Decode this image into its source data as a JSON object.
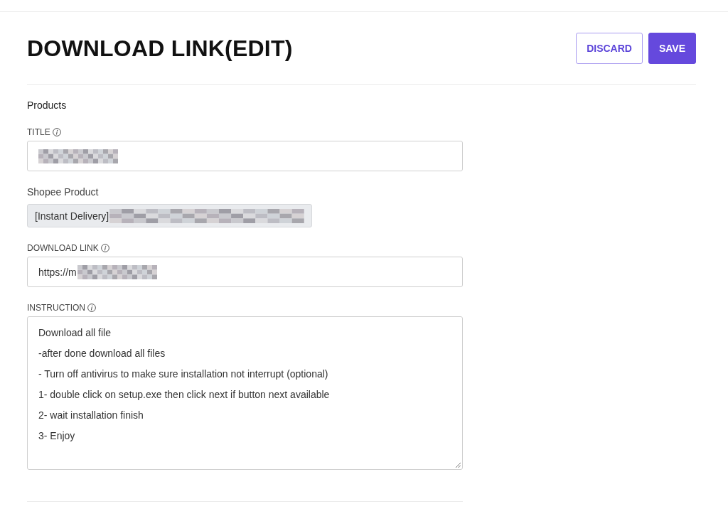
{
  "header": {
    "title": "DOWNLOAD LINK(EDIT)",
    "buttons": [
      {
        "label": "DISCARD",
        "kind": "outline"
      },
      {
        "label": "SAVE",
        "kind": "primary"
      }
    ]
  },
  "form": {
    "section": "Products",
    "fields": [
      {
        "kind": "text",
        "label": "TITLE",
        "info": true,
        "disabled": false,
        "redacted": true
      },
      {
        "kind": "readonly",
        "label": "Shopee Product",
        "info": false,
        "disabled": true,
        "value": "[Instant Delivery]",
        "redacted": true
      },
      {
        "kind": "text",
        "label": "DOWNLOAD LINK",
        "info": true,
        "disabled": false,
        "value": "https://m",
        "redacted": true
      },
      {
        "kind": "textarea",
        "label": "INSTRUCTION",
        "info": true,
        "disabled": false,
        "redacted": false,
        "lines": [
          "Download all file",
          "-after done download all files",
          "- Turn off antivirus to make sure installation not interrupt (optional)",
          "1- double click on setup.exe then click next if button next available",
          "2- wait installation finish",
          "3- Enjoy"
        ]
      }
    ]
  }
}
